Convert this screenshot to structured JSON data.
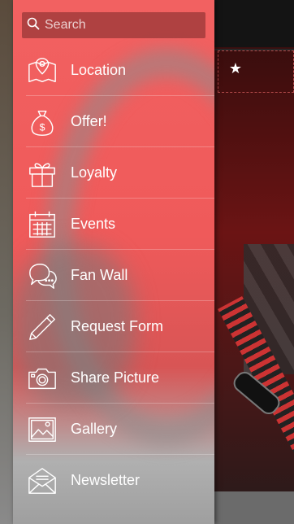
{
  "search": {
    "placeholder": "Search"
  },
  "menu": {
    "items": [
      {
        "label": "Location",
        "icon": "map-pin-icon"
      },
      {
        "label": "Offer!",
        "icon": "money-bag-icon"
      },
      {
        "label": "Loyalty",
        "icon": "gift-icon"
      },
      {
        "label": "Events",
        "icon": "calendar-icon"
      },
      {
        "label": "Fan Wall",
        "icon": "chat-bubbles-icon"
      },
      {
        "label": "Request Form",
        "icon": "pencil-icon"
      },
      {
        "label": "Share Picture",
        "icon": "camera-icon"
      },
      {
        "label": "Gallery",
        "icon": "image-icon"
      },
      {
        "label": "Newsletter",
        "icon": "envelope-icon"
      }
    ]
  },
  "colors": {
    "drawer": "#ef5a5a",
    "search_bg": "#7a2a2a",
    "text": "#ffffff"
  }
}
